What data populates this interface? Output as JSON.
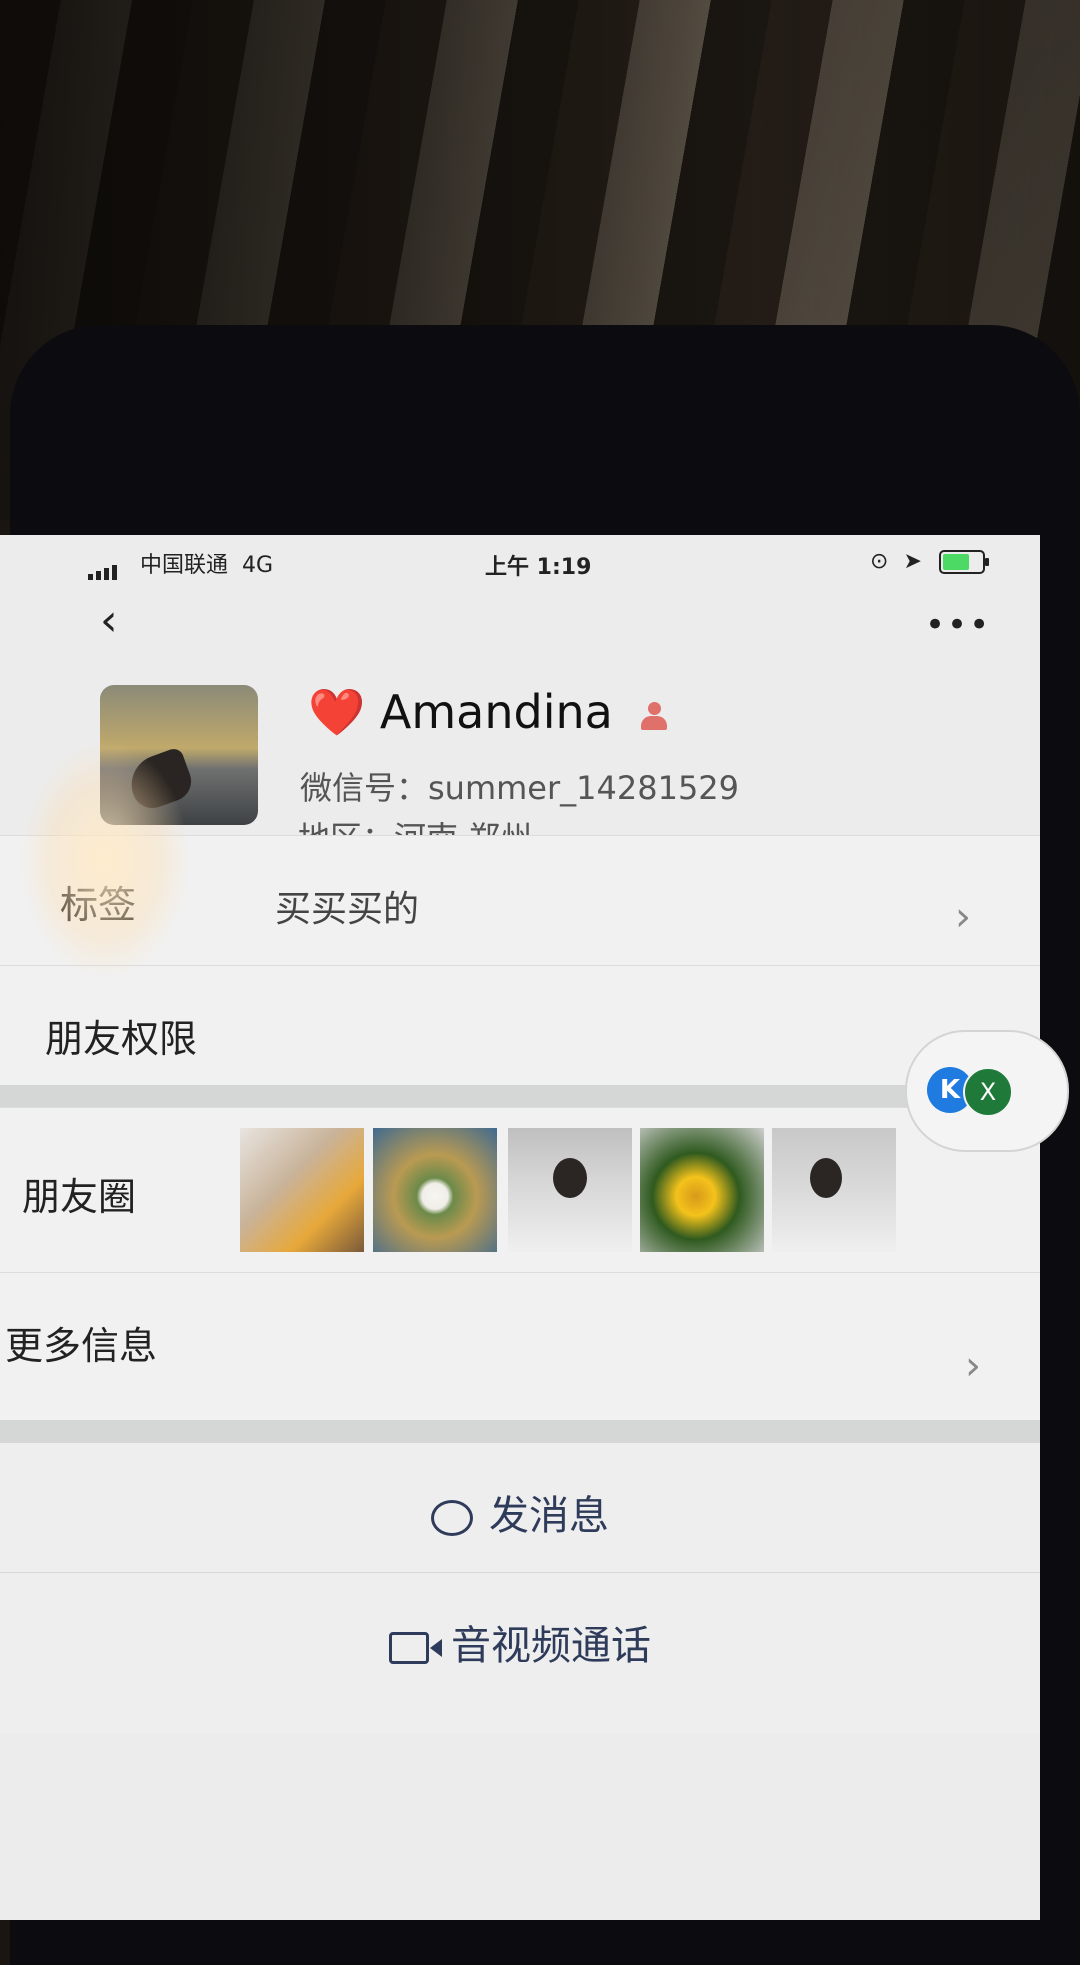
{
  "status_bar": {
    "carrier": "中国联通",
    "network": "4G",
    "time": "上午 1:19"
  },
  "nav": {
    "back_glyph": "‹",
    "more_glyph": "•••"
  },
  "profile": {
    "name_prefix": "❤️",
    "name": "Amandina",
    "wechat_id": "微信号：summer_14281529",
    "region": "地区：河南 郑州"
  },
  "rows": {
    "tags_label": "标签",
    "tags_value": "买买买的",
    "permissions_label": "朋友权限",
    "moments_label": "朋友圈",
    "more_info_label": "更多信息"
  },
  "actions": {
    "message": "发消息",
    "call": "音视频通话"
  },
  "float": {
    "k_label": "K",
    "x_label": "X"
  },
  "colors": {
    "heart": "#e02a2a",
    "action_text": "#2f3b5a",
    "battery_fill": "#4cd964"
  }
}
